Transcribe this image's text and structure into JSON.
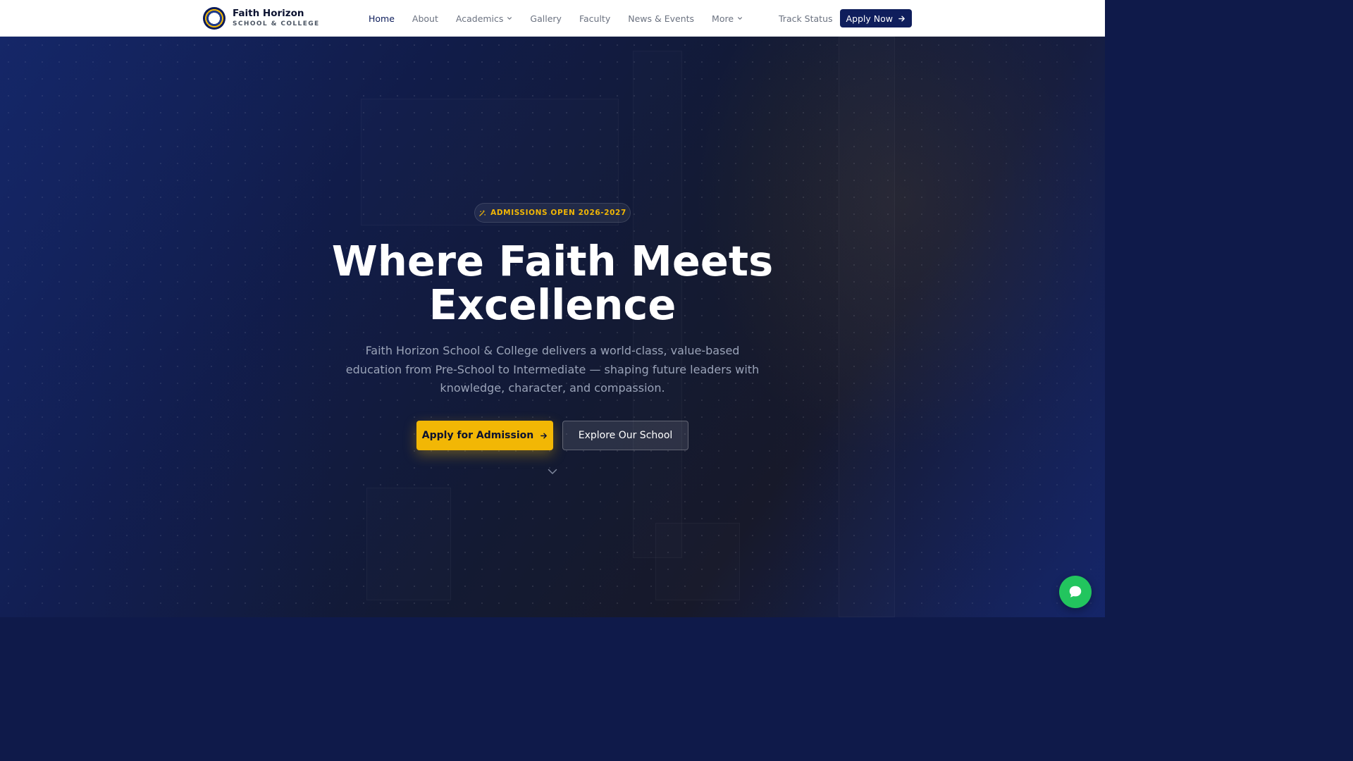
{
  "colors": {
    "brand_navy": "#0f1e5c",
    "accent_gold": "#f2b705",
    "chat_green": "#22c55e",
    "nav_text": "#6b7280"
  },
  "header": {
    "brand": {
      "name": "Faith Horizon",
      "subtitle": "SCHOOL & COLLEGE",
      "logo_icon": "school-crest-icon"
    },
    "nav": [
      {
        "label": "Home",
        "active": true
      },
      {
        "label": "About"
      },
      {
        "label": "Academics",
        "icon": "chevron-down-icon"
      },
      {
        "label": "Gallery"
      },
      {
        "label": "Faculty"
      },
      {
        "label": "News & Events"
      },
      {
        "label": "More",
        "icon": "chevron-down-icon"
      }
    ],
    "track_status": "Track Status",
    "apply_now": {
      "label": "Apply Now",
      "icon": "arrow-right-icon"
    }
  },
  "hero": {
    "badge": {
      "label": "ADMISSIONS OPEN 2026-2027",
      "icon": "sparkles-icon"
    },
    "title": "Where Faith Meets Excellence",
    "subtitle": "Faith Horizon School & College delivers a world-class, value-based education from Pre-School to Intermediate — shaping future leaders with knowledge, character, and compassion.",
    "primary_cta": {
      "label": "Apply for Admission",
      "icon": "arrow-right-icon"
    },
    "secondary_cta": {
      "label": "Explore Our School"
    },
    "scroll_icon": "chevron-down-icon"
  },
  "chat": {
    "icon": "chat-bubble-icon"
  }
}
